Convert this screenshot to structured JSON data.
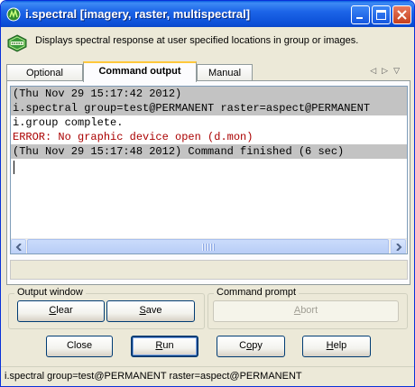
{
  "window": {
    "title": "i.spectral [imagery, raster, multispectral]",
    "description": "Displays spectral response at user specified locations in group or images.",
    "logo_text": "GRASS"
  },
  "tabs": [
    {
      "label": "Optional",
      "active": false
    },
    {
      "label": "Command output",
      "active": true
    },
    {
      "label": "Manual",
      "active": false
    }
  ],
  "output": {
    "lines": [
      {
        "text": "(Thu Nov 29 15:17:42 2012)",
        "kind": "cmd"
      },
      {
        "text": "i.spectral group=test@PERMANENT raster=aspect@PERMANENT",
        "kind": "cmd"
      },
      {
        "text": "i.group complete.",
        "kind": "normal"
      },
      {
        "text": "ERROR: No graphic device open (d.mon)",
        "kind": "error"
      },
      {
        "text": "(Thu Nov 29 15:17:48 2012) Command finished (6 sec)",
        "kind": "cmd"
      }
    ]
  },
  "output_window": {
    "label": "Output window",
    "clear": {
      "pre": "",
      "u": "C",
      "post": "lear"
    },
    "save": {
      "pre": "",
      "u": "S",
      "post": "ave"
    }
  },
  "command_prompt": {
    "label": "Command prompt",
    "abort": {
      "pre": "",
      "u": "A",
      "post": "bort"
    }
  },
  "buttons": {
    "close": {
      "pre": "Close",
      "u": "",
      "post": ""
    },
    "run": {
      "pre": "",
      "u": "R",
      "post": "un"
    },
    "copy": {
      "pre": "C",
      "u": "o",
      "post": "py"
    },
    "help": {
      "pre": "",
      "u": "H",
      "post": "elp"
    }
  },
  "statusbar": {
    "text": "i.spectral group=test@PERMANENT raster=aspect@PERMANENT"
  },
  "colors": {
    "titlebar": "#0b4fd7",
    "error_text": "#aa0000",
    "command_highlight": "#c3c3c3"
  }
}
